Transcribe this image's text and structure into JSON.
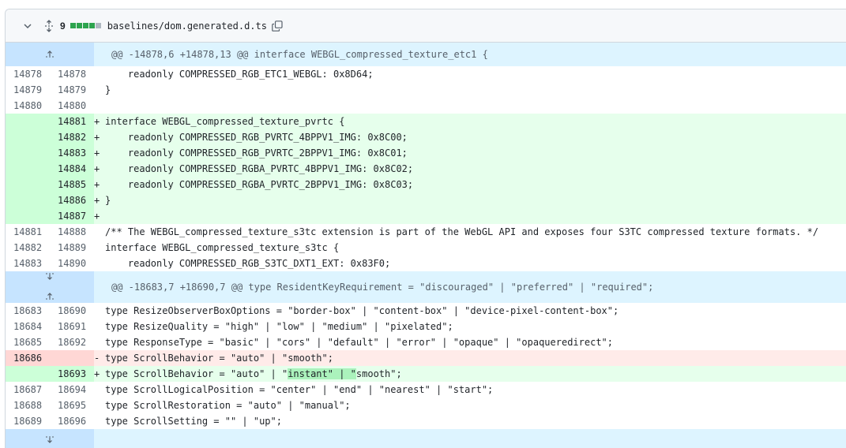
{
  "file": {
    "change_count": "9",
    "path": "baselines/dom.generated.d.ts",
    "diffstat": [
      "add",
      "add",
      "add",
      "add",
      "neutral"
    ],
    "colors": {
      "add": "#2da44e",
      "neutral": "#afb8c1",
      "hunk_bg": "#ddf4ff",
      "add_bg": "#e6ffec",
      "del_bg": "#ffebe9"
    }
  },
  "hunks": [
    {
      "header": "@@ -14878,6 +14878,13 @@ interface WEBGL_compressed_texture_etc1 {",
      "lines": [
        {
          "type": "ctx",
          "old": "14878",
          "new": "14878",
          "marker": " ",
          "text": "    readonly COMPRESSED_RGB_ETC1_WEBGL: 0x8D64;"
        },
        {
          "type": "ctx",
          "old": "14879",
          "new": "14879",
          "marker": " ",
          "text": "}"
        },
        {
          "type": "ctx",
          "old": "14880",
          "new": "14880",
          "marker": " ",
          "text": ""
        },
        {
          "type": "add",
          "old": "",
          "new": "14881",
          "marker": "+",
          "text": "interface WEBGL_compressed_texture_pvrtc {"
        },
        {
          "type": "add",
          "old": "",
          "new": "14882",
          "marker": "+",
          "text": "    readonly COMPRESSED_RGB_PVRTC_4BPPV1_IMG: 0x8C00;"
        },
        {
          "type": "add",
          "old": "",
          "new": "14883",
          "marker": "+",
          "text": "    readonly COMPRESSED_RGB_PVRTC_2BPPV1_IMG: 0x8C01;"
        },
        {
          "type": "add",
          "old": "",
          "new": "14884",
          "marker": "+",
          "text": "    readonly COMPRESSED_RGBA_PVRTC_4BPPV1_IMG: 0x8C02;"
        },
        {
          "type": "add",
          "old": "",
          "new": "14885",
          "marker": "+",
          "text": "    readonly COMPRESSED_RGBA_PVRTC_2BPPV1_IMG: 0x8C03;"
        },
        {
          "type": "add",
          "old": "",
          "new": "14886",
          "marker": "+",
          "text": "}"
        },
        {
          "type": "add",
          "old": "",
          "new": "14887",
          "marker": "+",
          "text": ""
        },
        {
          "type": "ctx",
          "old": "14881",
          "new": "14888",
          "marker": " ",
          "text": "/** The WEBGL_compressed_texture_s3tc extension is part of the WebGL API and exposes four S3TC compressed texture formats. */"
        },
        {
          "type": "ctx",
          "old": "14882",
          "new": "14889",
          "marker": " ",
          "text": "interface WEBGL_compressed_texture_s3tc {"
        },
        {
          "type": "ctx",
          "old": "14883",
          "new": "14890",
          "marker": " ",
          "text": "    readonly COMPRESSED_RGB_S3TC_DXT1_EXT: 0x83F0;"
        }
      ]
    },
    {
      "header": "@@ -18683,7 +18690,7 @@ type ResidentKeyRequirement = \"discouraged\" | \"preferred\" | \"required\";",
      "lines": [
        {
          "type": "ctx",
          "old": "18683",
          "new": "18690",
          "marker": " ",
          "text": "type ResizeObserverBoxOptions = \"border-box\" | \"content-box\" | \"device-pixel-content-box\";"
        },
        {
          "type": "ctx",
          "old": "18684",
          "new": "18691",
          "marker": " ",
          "text": "type ResizeQuality = \"high\" | \"low\" | \"medium\" | \"pixelated\";"
        },
        {
          "type": "ctx",
          "old": "18685",
          "new": "18692",
          "marker": " ",
          "text": "type ResponseType = \"basic\" | \"cors\" | \"default\" | \"error\" | \"opaque\" | \"opaqueredirect\";"
        },
        {
          "type": "del",
          "old": "18686",
          "new": "",
          "marker": "-",
          "text": "type ScrollBehavior = \"auto\" | \"smooth\";"
        },
        {
          "type": "add",
          "old": "",
          "new": "18693",
          "marker": "+",
          "text_before": "type ScrollBehavior = \"auto\" | \"",
          "text_hl": "instant\" | \"",
          "text_after": "smooth\";"
        },
        {
          "type": "ctx",
          "old": "18687",
          "new": "18694",
          "marker": " ",
          "text": "type ScrollLogicalPosition = \"center\" | \"end\" | \"nearest\" | \"start\";"
        },
        {
          "type": "ctx",
          "old": "18688",
          "new": "18695",
          "marker": " ",
          "text": "type ScrollRestoration = \"auto\" | \"manual\";"
        },
        {
          "type": "ctx",
          "old": "18689",
          "new": "18696",
          "marker": " ",
          "text": "type ScrollSetting = \"\" | \"up\";"
        }
      ]
    }
  ]
}
